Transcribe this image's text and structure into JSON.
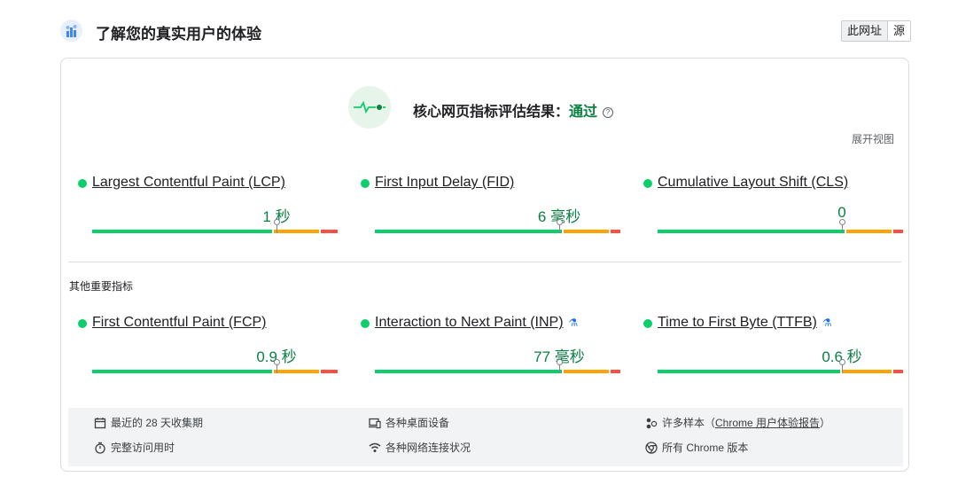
{
  "header": {
    "title": "了解您的真实用户的体验",
    "toggle": [
      "此网址",
      "源"
    ]
  },
  "assessment": {
    "label": "核心网页指标评估结果：",
    "result": "通过",
    "help": "?",
    "expand": "展开视图"
  },
  "core_metrics": [
    {
      "title": "Largest Contentful Paint (LCP)",
      "value": "1 秒",
      "good": 0.74,
      "ni": 0.19,
      "poor": 0.07
    },
    {
      "title": "First Input Delay (FID)",
      "value": "6 毫秒",
      "good": 0.77,
      "ni": 0.19,
      "poor": 0.04
    },
    {
      "title": "Cumulative Layout Shift (CLS)",
      "value": "0",
      "good": 0.77,
      "ni": 0.19,
      "poor": 0.04
    }
  ],
  "other_section_label": "其他重要指标",
  "other_metrics": [
    {
      "title": "First Contentful Paint (FCP)",
      "value": "0.9 秒",
      "good": 0.74,
      "ni": 0.19,
      "poor": 0.07,
      "lab": ""
    },
    {
      "title": "Interaction to Next Paint (INP)",
      "value": "77 毫秒",
      "good": 0.77,
      "ni": 0.19,
      "poor": 0.04,
      "lab": "⚗"
    },
    {
      "title": "Time to First Byte (TTFB)",
      "value": "0.6 秒",
      "good": 0.75,
      "ni": 0.21,
      "poor": 0.04,
      "lab": "⚗"
    }
  ],
  "footer": {
    "period": "最近的 28 天收集期",
    "devices": "各种桌面设备",
    "samples_prefix": "许多样本（",
    "samples_link": "Chrome 用户体验报告",
    "samples_suffix": "）",
    "duration": "完整访问用时",
    "network": "各种网络连接状况",
    "versions": "所有 Chrome 版本"
  },
  "colors": {
    "good": "#0cce6b",
    "needs_improvement": "#ffa400",
    "poor": "#ff4e42",
    "pass_text": "#0b8043"
  }
}
